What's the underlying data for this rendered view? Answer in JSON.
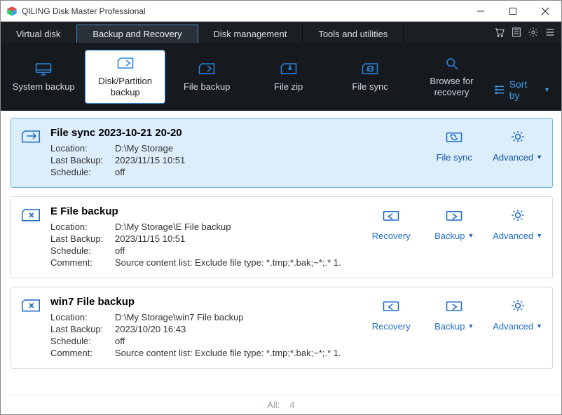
{
  "window": {
    "title": "QILING Disk Master Professional"
  },
  "tabs": {
    "items": [
      "Virtual disk",
      "Backup and Recovery",
      "Disk management",
      "Tools and utilities"
    ],
    "activeIndex": 1
  },
  "toolbar": {
    "items": [
      {
        "label": "System backup"
      },
      {
        "label": "Disk/Partition backup"
      },
      {
        "label": "File backup"
      },
      {
        "label": "File zip"
      },
      {
        "label": "File sync"
      },
      {
        "label": "Browse for recovery"
      }
    ],
    "activeIndex": 1,
    "sort_label": "Sort by"
  },
  "labels": {
    "location": "Location:",
    "last_backup": "Last Backup:",
    "schedule": "Schedule:",
    "comment": "Comment:",
    "recovery": "Recovery",
    "backup": "Backup",
    "advanced": "Advanced",
    "filesync": "File sync"
  },
  "tasks": [
    {
      "name": "File sync 2023-10-21 20-20",
      "location": "D:\\My Storage",
      "last_backup": "2023/11/15 10:51",
      "schedule": "off",
      "comment": null,
      "type": "sync",
      "selected": true
    },
    {
      "name": "E  File backup",
      "location": "D:\\My Storage\\E  File backup",
      "last_backup": "2023/11/15 10:51",
      "schedule": "off",
      "comment": "Source content list:  Exclude file type: *.tmp;*.bak;~*;.*        1.",
      "type": "backup",
      "selected": false
    },
    {
      "name": "win7 File backup",
      "location": "D:\\My Storage\\win7 File backup",
      "last_backup": "2023/10/20 16:43",
      "schedule": "off",
      "comment": "Source content list:  Exclude file type: *.tmp;*.bak;~*;.*        1.",
      "type": "backup",
      "selected": false
    }
  ],
  "footer": {
    "all_label": "All:",
    "count": "4"
  },
  "colors": {
    "accent": "#2a82d9",
    "toolbar_bg": "#161a1f"
  }
}
